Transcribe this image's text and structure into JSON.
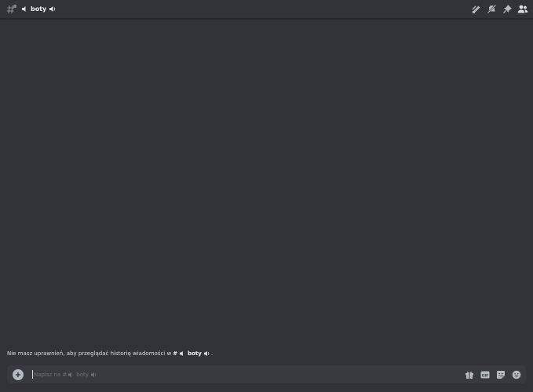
{
  "header": {
    "channel_name": "boty",
    "icons": [
      "text-channel-icon",
      "speaker-icon",
      "threads-icon",
      "mute-icon",
      "pin-icon",
      "member-list-icon"
    ]
  },
  "notice": {
    "text": "Nie masz uprawnień, aby przeglądać historię wiadomości w",
    "hash": "#",
    "channel": "boty",
    "end": "."
  },
  "composer": {
    "placeholder_prefix": "Napisz na #",
    "placeholder_channel": "boty",
    "tools": [
      "gift-icon",
      "gif-icon",
      "sticker-icon",
      "emoji-icon"
    ],
    "gif_label": "GIF"
  },
  "colors": {
    "background": "#313338",
    "composer": "#383a40",
    "text": "#dbdee1",
    "icon": "#b5bac1",
    "placeholder": "#6d6f78"
  }
}
